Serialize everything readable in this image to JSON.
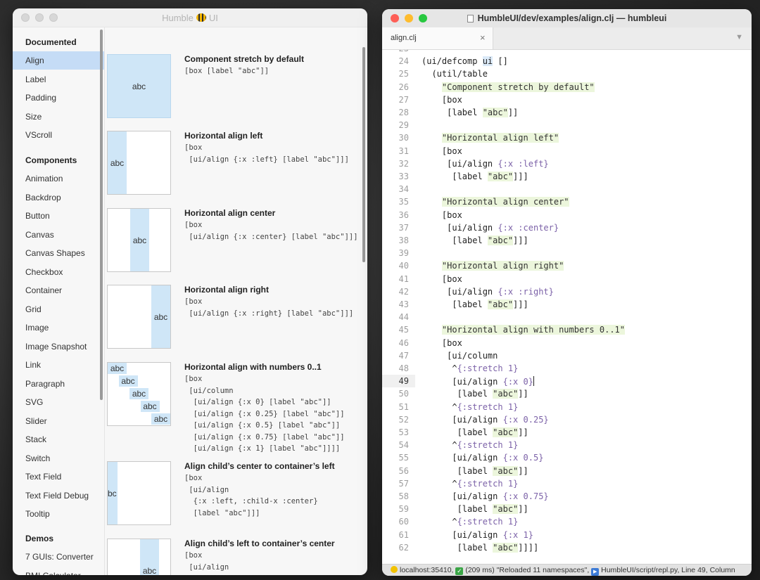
{
  "left_window": {
    "title": "Humble",
    "title_suffix": "UI",
    "sidebar": {
      "sections": [
        {
          "label": "Documented",
          "items": [
            "Align",
            "Label",
            "Padding",
            "Size",
            "VScroll"
          ]
        },
        {
          "label": "Components",
          "items": [
            "Animation",
            "Backdrop",
            "Button",
            "Canvas",
            "Canvas Shapes",
            "Checkbox",
            "Container",
            "Grid",
            "Image",
            "Image Snapshot",
            "Link",
            "Paragraph",
            "SVG",
            "Slider",
            "Stack",
            "Switch",
            "Text Field",
            "Text Field Debug",
            "Tooltip"
          ]
        },
        {
          "label": "Demos",
          "items": [
            "7 GUIs: Converter",
            "BMI Calculator"
          ]
        }
      ],
      "selected": "Align"
    },
    "examples": [
      {
        "title": "Component stretch by default",
        "code": "[box [label \"abc\"]]",
        "preview_text": "abc"
      },
      {
        "title": "Horizontal align left",
        "code": "[box\n [ui/align {:x :left} [label \"abc\"]]]",
        "preview_text": "abc"
      },
      {
        "title": "Horizontal align center",
        "code": "[box\n [ui/align {:x :center} [label \"abc\"]]]",
        "preview_text": "abc"
      },
      {
        "title": "Horizontal align right",
        "code": "[box\n [ui/align {:x :right} [label \"abc\"]]]",
        "preview_text": "abc"
      },
      {
        "title": "Horizontal align with numbers 0..1",
        "code": "[box\n [ui/column\n  [ui/align {:x 0} [label \"abc\"]]\n  [ui/align {:x 0.25} [label \"abc\"]]\n  [ui/align {:x 0.5} [label \"abc\"]]\n  [ui/align {:x 0.75} [label \"abc\"]]\n  [ui/align {:x 1} [label \"abc\"]]]]",
        "preview_text": "abc"
      },
      {
        "title": "Align child’s center to container’s left",
        "code": "[box\n [ui/align\n  {:x :left, :child-x :center}\n  [label \"abc\"]]]",
        "preview_text": "bc"
      },
      {
        "title": "Align child’s left to container’s center",
        "code": "[box\n [ui/align\n  {:x :center, :child-x :left}",
        "preview_text": "abc"
      }
    ]
  },
  "right_window": {
    "title": "HumbleUI/dev/examples/align.clj — humbleui",
    "tab_label": "align.clj",
    "tab_close": "×",
    "tab_menu": "▼",
    "current_line": 49,
    "lines": [
      {
        "n": 23,
        "text": ""
      },
      {
        "n": 24,
        "text": "(ui/defcomp ui []"
      },
      {
        "n": 25,
        "text": "  (util/table"
      },
      {
        "n": 26,
        "text": "    \"Component stretch by default\""
      },
      {
        "n": 27,
        "text": "    [box"
      },
      {
        "n": 28,
        "text": "     [label \"abc\"]]"
      },
      {
        "n": 29,
        "text": ""
      },
      {
        "n": 30,
        "text": "    \"Horizontal align left\""
      },
      {
        "n": 31,
        "text": "    [box"
      },
      {
        "n": 32,
        "text": "     [ui/align {:x :left}"
      },
      {
        "n": 33,
        "text": "      [label \"abc\"]]]"
      },
      {
        "n": 34,
        "text": ""
      },
      {
        "n": 35,
        "text": "    \"Horizontal align center\""
      },
      {
        "n": 36,
        "text": "    [box"
      },
      {
        "n": 37,
        "text": "     [ui/align {:x :center}"
      },
      {
        "n": 38,
        "text": "      [label \"abc\"]]]"
      },
      {
        "n": 39,
        "text": ""
      },
      {
        "n": 40,
        "text": "    \"Horizontal align right\""
      },
      {
        "n": 41,
        "text": "    [box"
      },
      {
        "n": 42,
        "text": "     [ui/align {:x :right}"
      },
      {
        "n": 43,
        "text": "      [label \"abc\"]]]"
      },
      {
        "n": 44,
        "text": ""
      },
      {
        "n": 45,
        "text": "    \"Horizontal align with numbers 0..1\""
      },
      {
        "n": 46,
        "text": "    [box"
      },
      {
        "n": 47,
        "text": "     [ui/column"
      },
      {
        "n": 48,
        "text": "      ^{:stretch 1}"
      },
      {
        "n": 49,
        "text": "      [ui/align {:x 0}"
      },
      {
        "n": 50,
        "text": "       [label \"abc\"]]"
      },
      {
        "n": 51,
        "text": "      ^{:stretch 1}"
      },
      {
        "n": 52,
        "text": "      [ui/align {:x 0.25}"
      },
      {
        "n": 53,
        "text": "       [label \"abc\"]]"
      },
      {
        "n": 54,
        "text": "      ^{:stretch 1}"
      },
      {
        "n": 55,
        "text": "      [ui/align {:x 0.5}"
      },
      {
        "n": 56,
        "text": "       [label \"abc\"]]"
      },
      {
        "n": 57,
        "text": "      ^{:stretch 1}"
      },
      {
        "n": 58,
        "text": "      [ui/align {:x 0.75}"
      },
      {
        "n": 59,
        "text": "       [label \"abc\"]]"
      },
      {
        "n": 60,
        "text": "      ^{:stretch 1}"
      },
      {
        "n": 61,
        "text": "      [ui/align {:x 1}"
      },
      {
        "n": 62,
        "text": "       [label \"abc\"]]]]"
      }
    ],
    "status": {
      "server": "localhost:35410,",
      "timing": "(209 ms)",
      "message": "\"Reloaded 11 namespaces\",",
      "repl": "HumbleUI/script/repl.py, Line 49, Column"
    }
  },
  "colors": {
    "selection": "#c5dcf6",
    "label_fill": "#cfe6f7",
    "string_bg": "#ecf6dc",
    "keyword": "#7c62a8"
  }
}
